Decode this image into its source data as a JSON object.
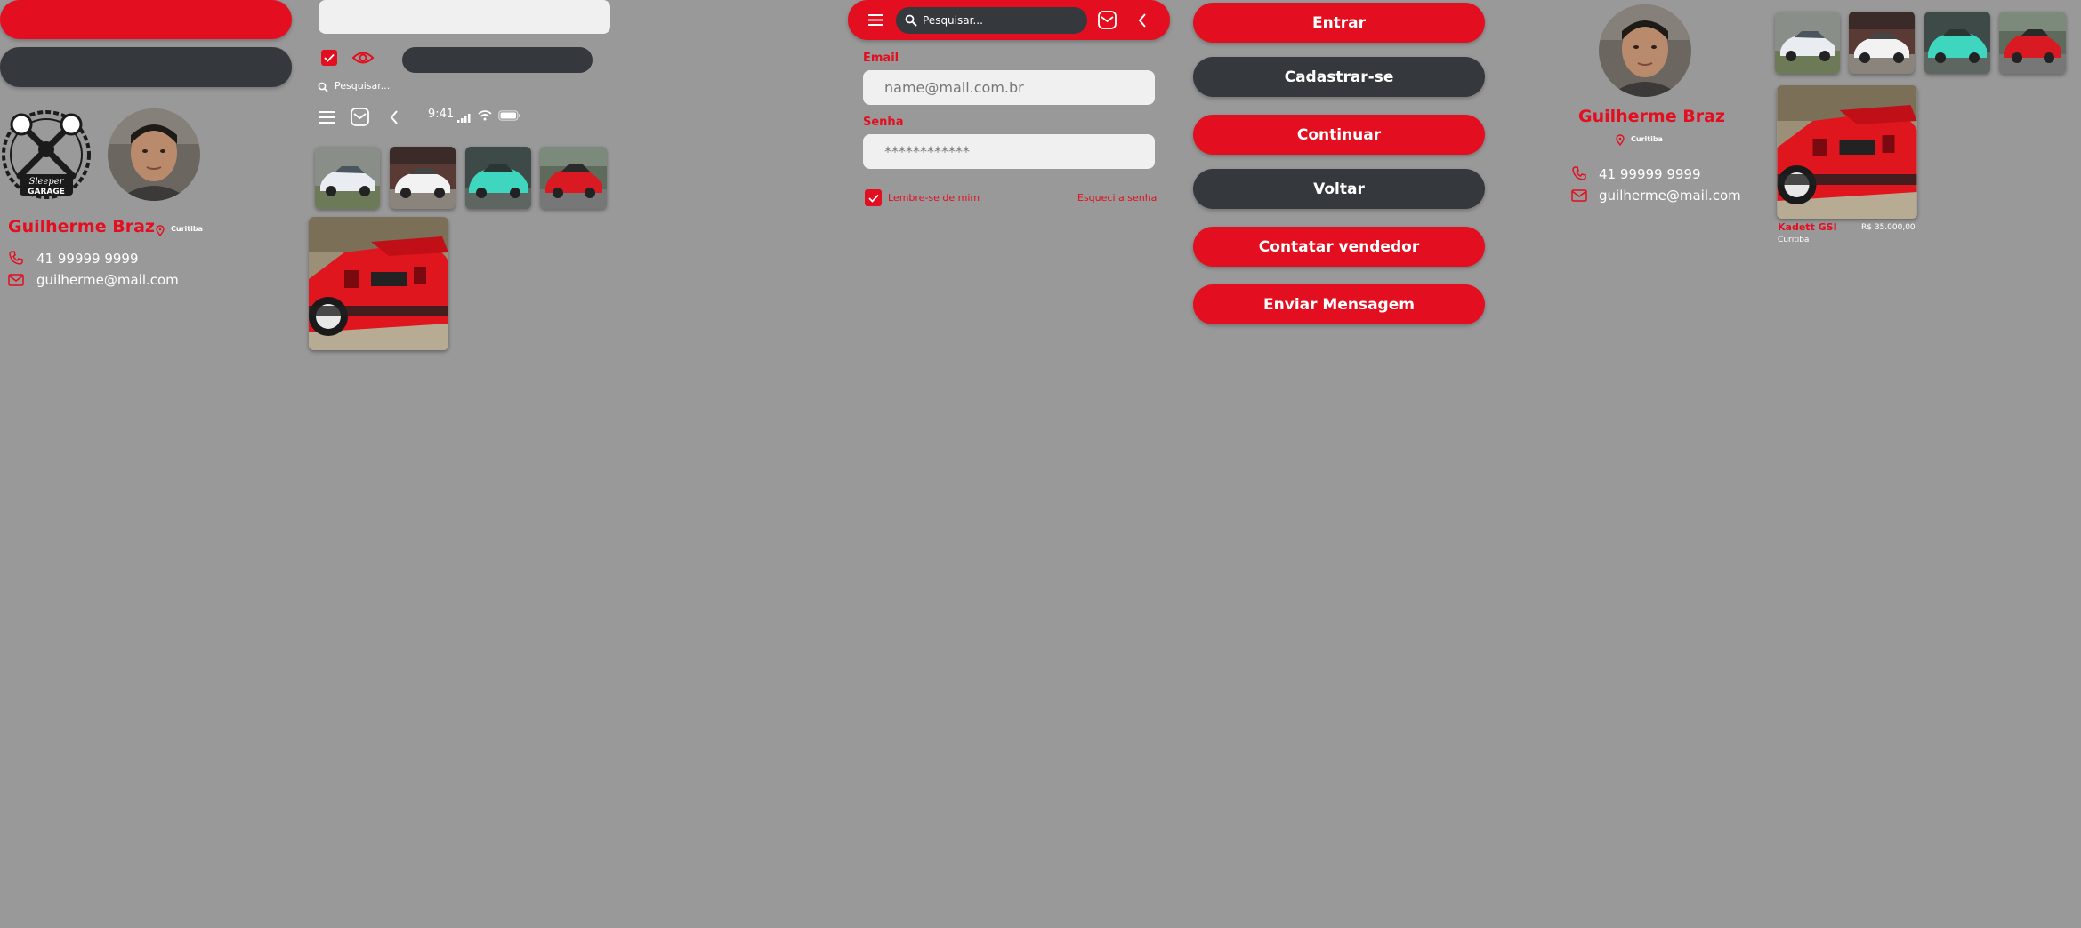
{
  "profile": {
    "name": "Guilherme Braz",
    "city": "Curitiba",
    "phone": "41 99999 9999",
    "email": "guilherme@mail.com"
  },
  "search": {
    "placeholder": "Pesquisar..."
  },
  "status_bar": {
    "time": "9:41"
  },
  "login": {
    "email_label": "Email",
    "email_placeholder": "name@mail.com.br",
    "password_label": "Senha",
    "password_value": "************",
    "remember_label": "Lembre-se de mim",
    "forgot_label": "Esqueci a senha"
  },
  "buttons": {
    "entrar": "Entrar",
    "cadastrar": "Cadastrar-se",
    "continuar": "Continuar",
    "voltar": "Voltar",
    "contatar": "Contatar vendedor",
    "enviar": "Enviar Mensagem"
  },
  "logo": {
    "line1": "Sleeper",
    "line2": "GARAGE"
  },
  "listing": {
    "title": "Kadett GSI",
    "price": "R$ 35.000,00",
    "city": "Curitiba"
  },
  "colors": {
    "accent": "#e30e1f",
    "dark": "#35383d",
    "background": "#999999"
  },
  "icons": [
    "menu-icon",
    "mail-icon",
    "back-icon",
    "search-icon",
    "phone-icon",
    "location-pin-icon",
    "eye-icon",
    "check-icon",
    "wifi-icon",
    "signal-icon",
    "battery-icon"
  ]
}
